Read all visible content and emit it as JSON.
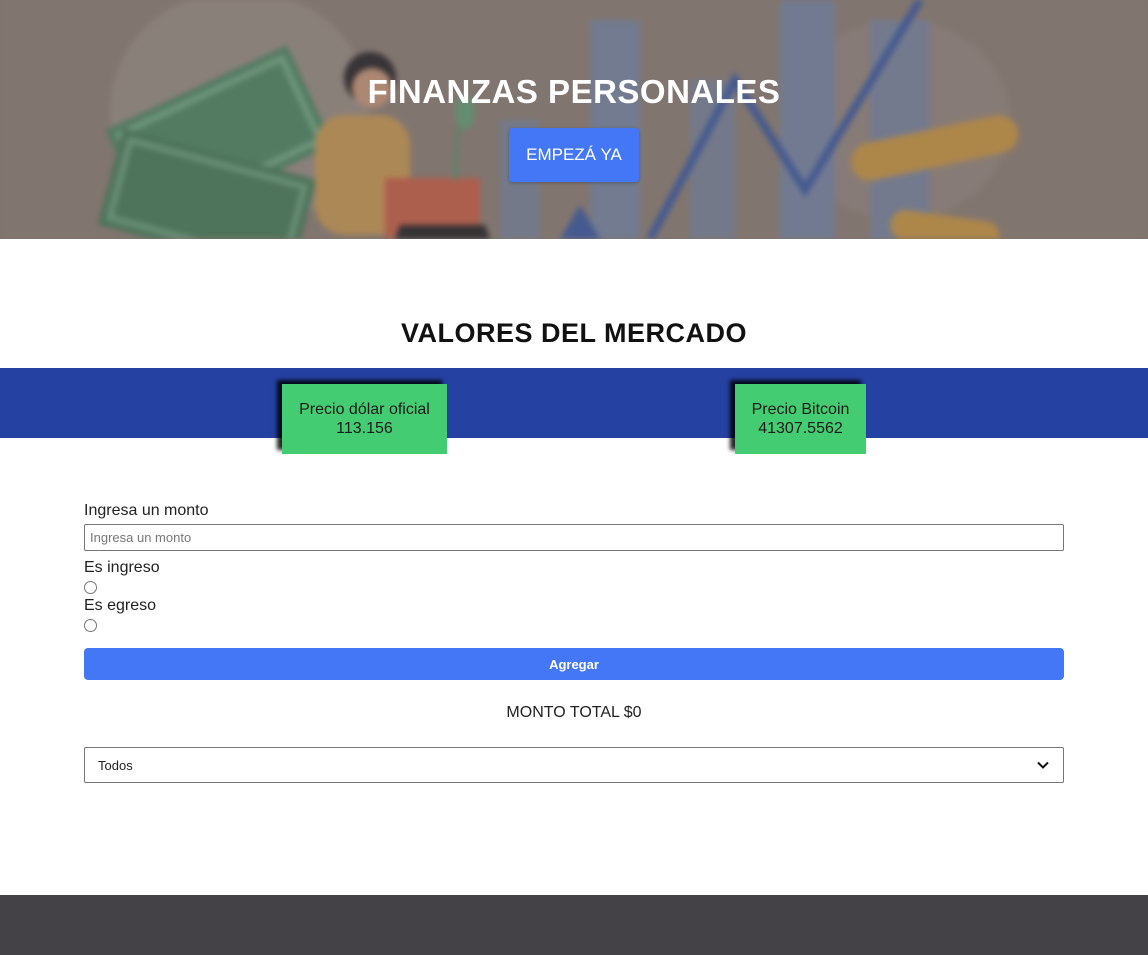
{
  "hero": {
    "title": "FINANZAS PERSONALES",
    "cta_label": "EMPEZÁ YA"
  },
  "market": {
    "title": "VALORES DEL MERCADO",
    "dolar": {
      "label": "Precio dólar oficial",
      "value": "113.156"
    },
    "bitcoin": {
      "label": "Precio Bitcoin",
      "value": "41307.5562"
    }
  },
  "form": {
    "amount_label": "Ingresa un monto",
    "amount_placeholder": "Ingresa un monto",
    "amount_value": "",
    "income_label": "Es ingreso",
    "expense_label": "Es egreso",
    "submit_label": "Agregar",
    "total_label": "MONTO TOTAL $0",
    "filter_selected": "Todos"
  },
  "colors": {
    "accent": "#4477f5",
    "band": "#2541a2",
    "card": "#43cc71",
    "footer": "#444247"
  }
}
